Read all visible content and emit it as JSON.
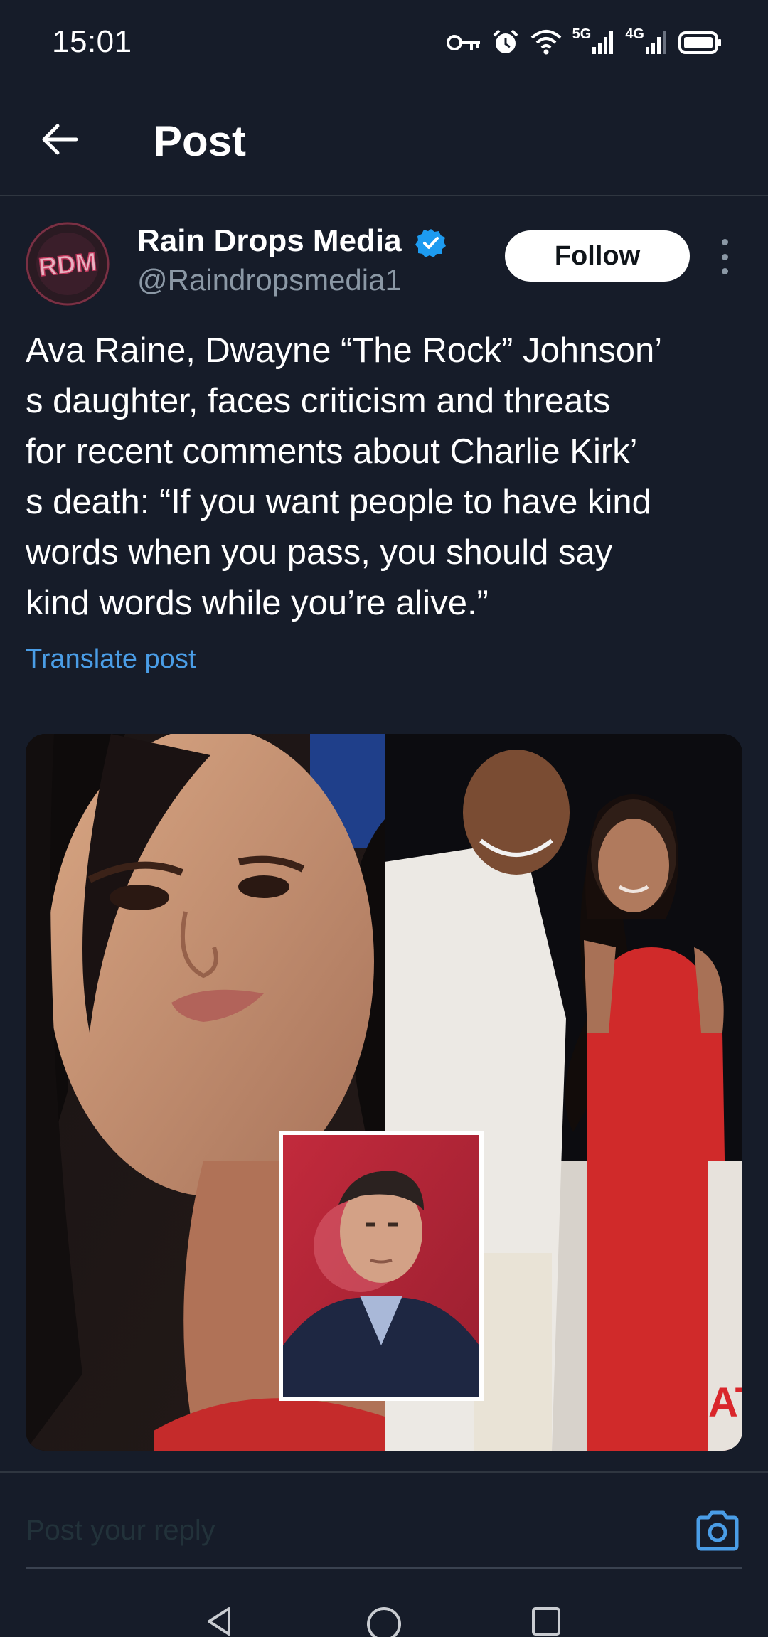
{
  "status_bar": {
    "time": "15:01",
    "network_1": "5G",
    "network_2": "4G",
    "icons": [
      "key-icon",
      "alarm-icon",
      "wifi-icon",
      "signal-icon",
      "signal-icon",
      "battery-icon"
    ]
  },
  "app_bar": {
    "title": "Post",
    "back_icon": "arrow-left-icon"
  },
  "post": {
    "author_name": "Rain Drops Media",
    "author_handle": "@Raindropsmedia1",
    "avatar_text": "RDM",
    "verified": true,
    "follow_label": "Follow",
    "text": "Ava Raine, Dwayne “The Rock” Johnson’\ns daughter, faces criticism and threats\nfor recent comments about Charlie Kirk’\ns death: “If you want people to have kind\nwords when you pass, you should say\nkind words while you’re alive.”",
    "translate_label": "Translate post",
    "media_sign_text": "AT"
  },
  "reply_bar": {
    "placeholder": "Post your reply",
    "camera_icon": "camera-icon"
  },
  "nav_bar": {
    "icons": [
      "nav-back-icon",
      "nav-home-icon",
      "nav-recents-icon"
    ]
  },
  "colors": {
    "background": "#161c29",
    "accent_blue": "#4a9de6",
    "verified_blue": "#1d9bf0",
    "secondary_text": "#8b98a5",
    "follow_bg": "#ffffff"
  }
}
